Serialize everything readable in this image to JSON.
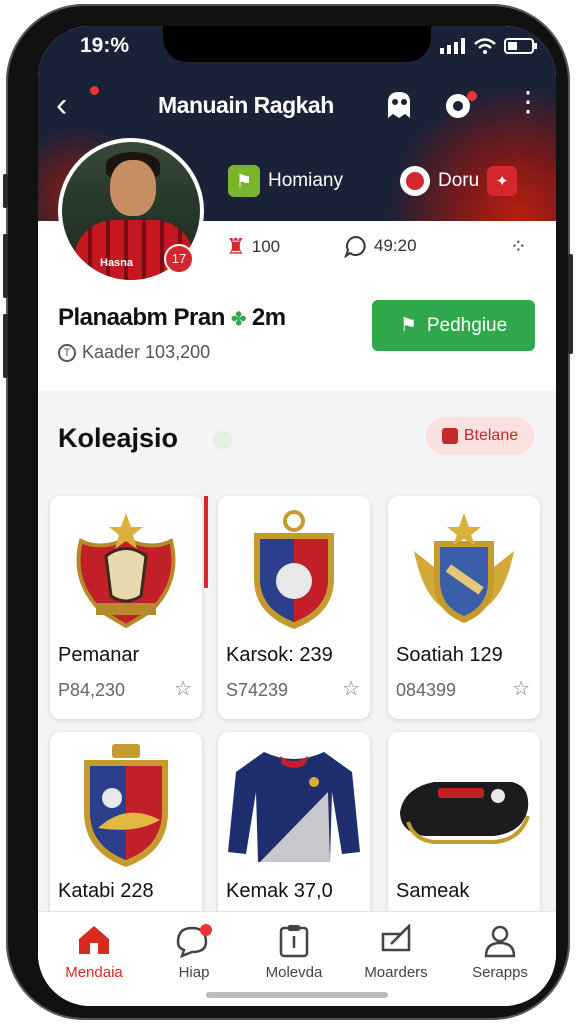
{
  "status": {
    "time": "19:%"
  },
  "topbar": {
    "title": "Manuain Ragkah"
  },
  "profile": {
    "jersey_text": "Hasna",
    "jersey_number": "17",
    "chip1_label": "Homiany",
    "chip2_label": "Doru",
    "likes": "100",
    "comments": "49:20",
    "name": "Planaabm Pran",
    "name_suffix": "2m",
    "sub": "Kaader 103,200",
    "primary_button": "Pedhgiue"
  },
  "section": {
    "title": "Koleajsio",
    "button": "Btelane"
  },
  "cards": [
    {
      "name": "Pemanar",
      "price": "P84,230"
    },
    {
      "name": "Karsok: 239",
      "price": "S74239"
    },
    {
      "name": "Soatiah 129",
      "price": "084399"
    },
    {
      "name": "Katabi 228",
      "price": ""
    },
    {
      "name": "Kemak 37,0",
      "price": ""
    },
    {
      "name": "Sameak",
      "price": ""
    }
  ],
  "nav": [
    {
      "label": "Mendaia",
      "icon": "home-icon"
    },
    {
      "label": "Hiap",
      "icon": "chat-icon"
    },
    {
      "label": "Molevda",
      "icon": "clipboard-icon"
    },
    {
      "label": "Moarders",
      "icon": "edit-icon"
    },
    {
      "label": "Serapps",
      "icon": "user-icon"
    }
  ],
  "colors": {
    "accent": "#d92a20",
    "green": "#2ea84a",
    "header_bg": "#1a2238"
  }
}
